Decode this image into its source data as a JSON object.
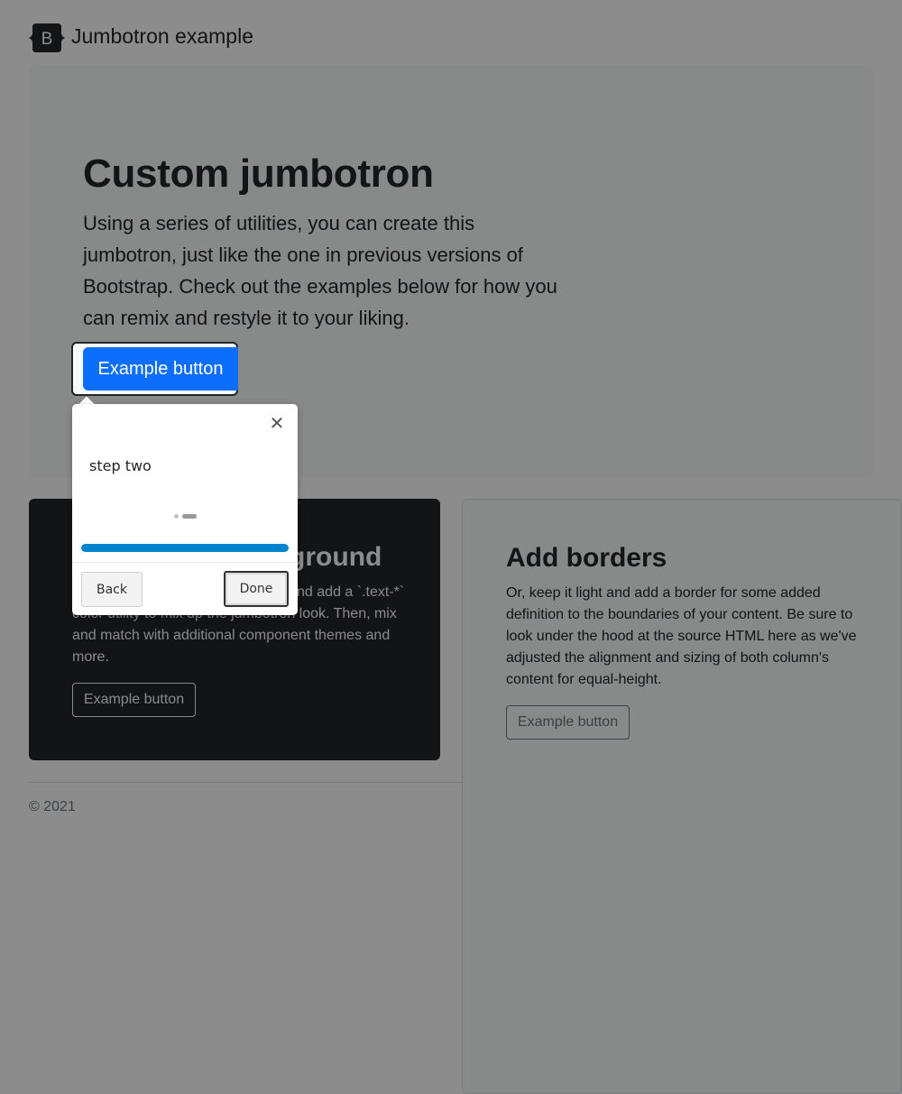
{
  "header": {
    "brand_text": "Jumbotron example",
    "logo_letter": "B"
  },
  "jumbotron": {
    "title": "Custom jumbotron",
    "lead": "Using a series of utilities, you can create this jumbotron, just like the one in previous versions of Bootstrap. Check out the examples below for how you can remix and restyle it to your liking.",
    "button_label": "Example button"
  },
  "dark_card": {
    "title": "Change the background",
    "text": "Swap the background-color utility and add a `.text-*` color utility to mix up the jumbotron look. Then, mix and match with additional component themes and more.",
    "button_label": "Example button"
  },
  "light_card": {
    "title": "Add borders",
    "text": "Or, keep it light and add a border for some added definition to the boundaries of your content. Be sure to look under the hood at the source HTML here as we've adjusted the alignment and sizing of both column's content for equal-height.",
    "button_label": "Example button"
  },
  "footer": {
    "text": "© 2021"
  },
  "tour": {
    "close_glyph": "✕",
    "step_text": "step two",
    "progress_fraction": 1.0,
    "back_label": "Back",
    "done_label": "Done",
    "accent_color": "#0085cc"
  },
  "colors": {
    "primary": "#0d6efd",
    "dark": "#212529",
    "light": "#f8f9fa"
  }
}
